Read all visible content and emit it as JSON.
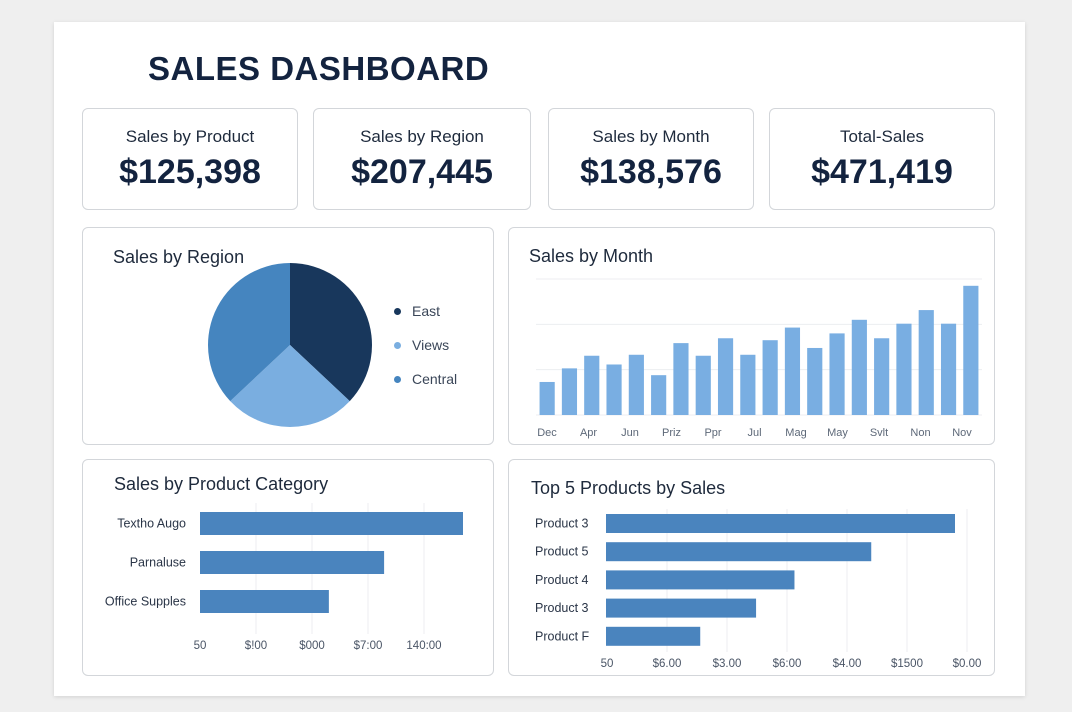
{
  "dashboard": {
    "title": "SALES DASHBOARD"
  },
  "kpis": [
    {
      "label": "Sales by Product",
      "value": "$125,398"
    },
    {
      "label": "Sales by Region",
      "value": "$207,445"
    },
    {
      "label": "Sales by Month",
      "value": "$138,576"
    },
    {
      "label": "Total-Sales",
      "value": "$471,419"
    }
  ],
  "region_panel": {
    "title": "Sales by Region"
  },
  "month_panel": {
    "title": "Sales by Month"
  },
  "category_panel": {
    "title": "Sales by Product Category"
  },
  "top_panel": {
    "title": "Top 5 Products by Sales"
  },
  "colors": {
    "dark": "#18375c",
    "mid": "#4585bf",
    "light": "#7aaee0",
    "bar": "#4a84be",
    "column": "#79aee2"
  },
  "chart_data": [
    {
      "type": "pie",
      "title": "Sales by Region",
      "slices": [
        {
          "name": "East",
          "value": 37,
          "color": "#18375c"
        },
        {
          "name": "Views",
          "value": 26,
          "color": "#7aaee0"
        },
        {
          "name": "Central",
          "value": 37,
          "color": "#4585bf"
        }
      ],
      "legend": [
        "East",
        "Views",
        "Central"
      ],
      "legend_position": "right"
    },
    {
      "type": "bar",
      "title": "Sales by Month",
      "values": [
        34,
        48,
        61,
        52,
        62,
        41,
        74,
        61,
        79,
        62,
        77,
        90,
        69,
        84,
        98,
        79,
        94,
        108,
        94,
        133
      ],
      "tick_labels": [
        "Dec",
        "Apr",
        "Jun",
        "Priz",
        "Ppr",
        "Jul",
        "Mag",
        "May",
        "Svlt",
        "Non",
        "Nov"
      ],
      "ylim": [
        0,
        140
      ],
      "grid": true
    },
    {
      "type": "bar",
      "orientation": "horizontal",
      "title": "Sales by Product Category",
      "categories": [
        "Textho Augo",
        "Parnaluse",
        "Office Supples"
      ],
      "values": [
        100,
        70,
        49
      ],
      "tick_labels": [
        "50",
        "$!00",
        "$000",
        "$7:00",
        "140:00"
      ],
      "xlim": [
        0,
        100
      ],
      "grid": true
    },
    {
      "type": "bar",
      "orientation": "horizontal",
      "title": "Top 5 Products by Sales",
      "categories": [
        "Product 3",
        "Product 5",
        "Product 4",
        "Product 3",
        "Product F"
      ],
      "values": [
        100,
        76,
        54,
        43,
        27
      ],
      "tick_labels": [
        "50",
        "$6.00",
        "$3.00",
        "$6:00",
        "$4.00",
        "$1500",
        "$0.00"
      ],
      "xlim": [
        0,
        100
      ],
      "grid": true
    }
  ]
}
